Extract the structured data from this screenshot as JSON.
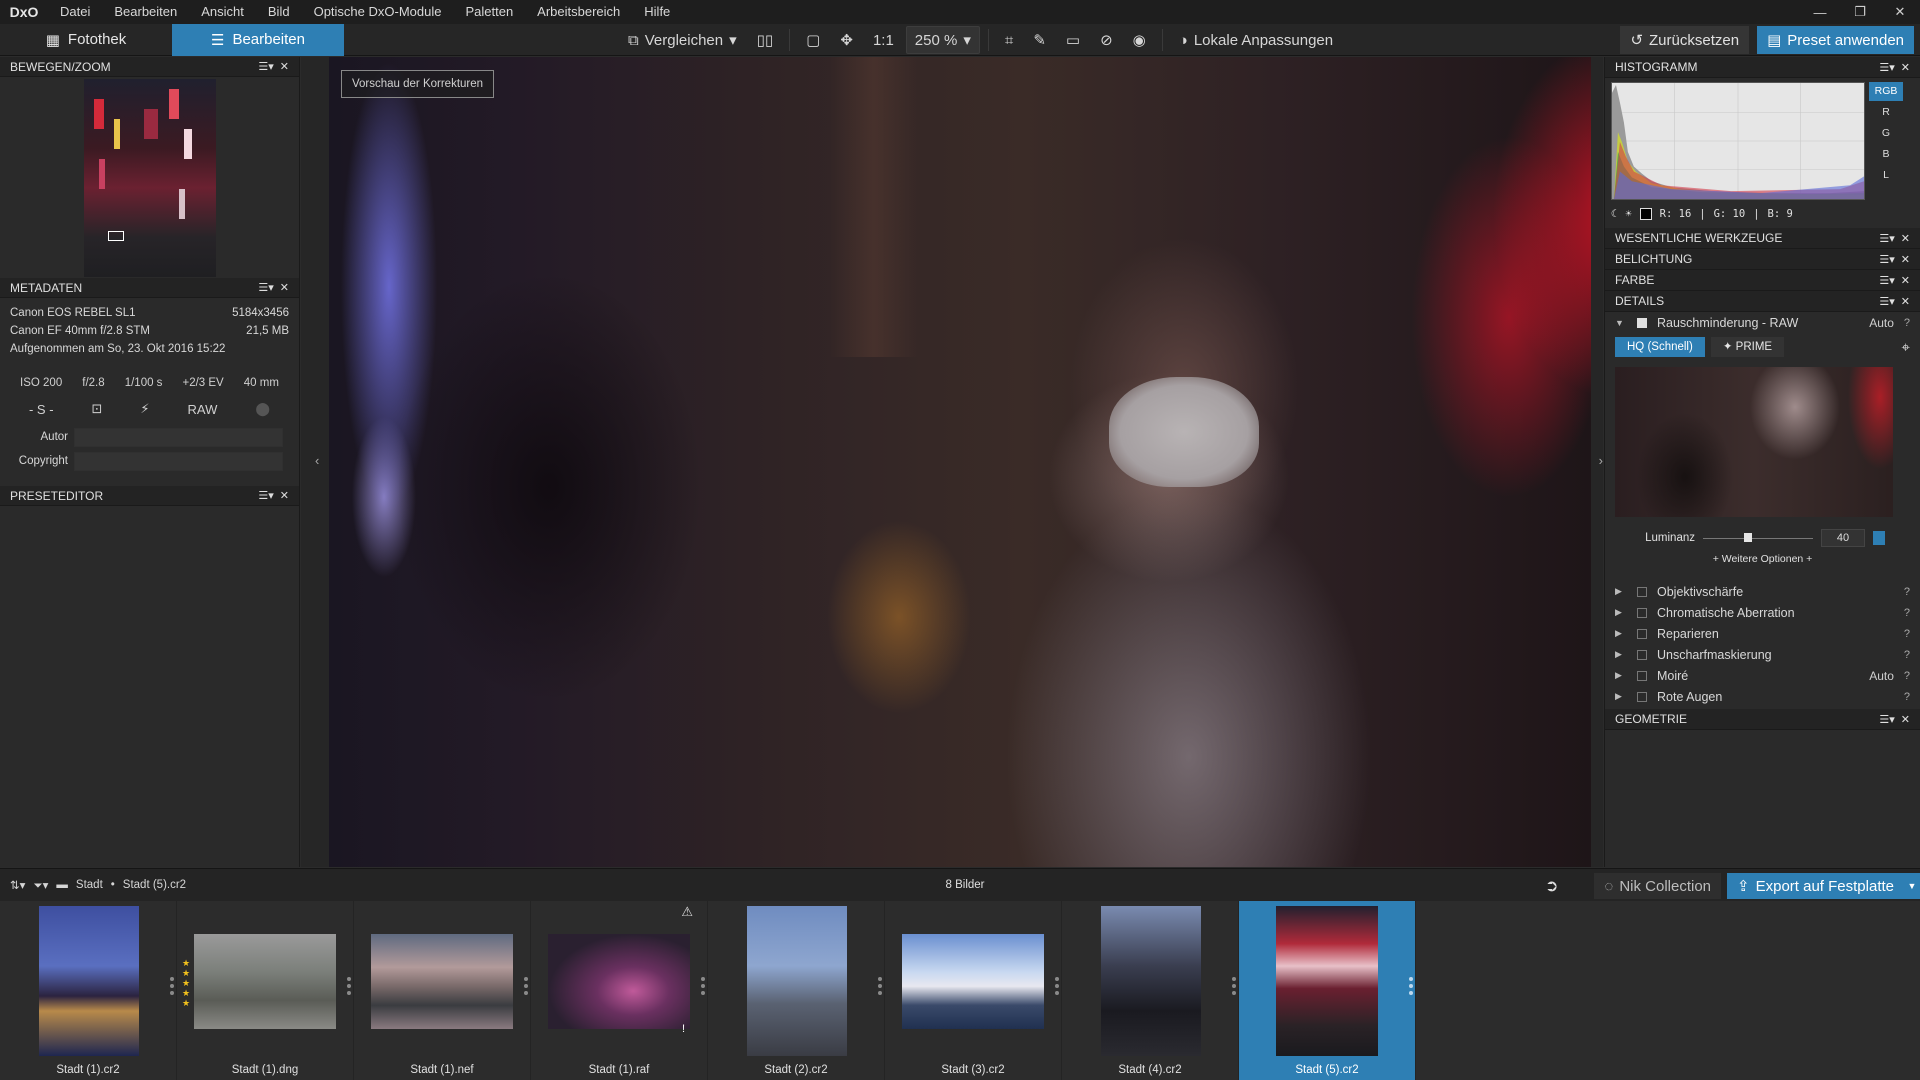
{
  "app": {
    "logo": "DxO",
    "menu": [
      "Datei",
      "Bearbeiten",
      "Ansicht",
      "Bild",
      "Optische DxO-Module",
      "Paletten",
      "Arbeitsbereich",
      "Hilfe"
    ]
  },
  "toolbar": {
    "tab_library": "Fotothek",
    "tab_edit": "Bearbeiten",
    "compare": "Vergleichen",
    "ratio": "1:1",
    "zoom": "250 %",
    "local_adjust": "Lokale Anpassungen",
    "reset": "Zurücksetzen",
    "apply_preset": "Preset anwenden"
  },
  "left": {
    "navigator_title": "BEWEGEN/ZOOM",
    "metadata_title": "METADATEN",
    "camera": "Canon EOS REBEL SL1",
    "resolution": "5184x3456",
    "lens": "Canon EF 40mm f/2.8 STM",
    "filesize": "21,5 MB",
    "taken": "Aufgenommen am So, 23. Okt 2016 15:22",
    "exif": [
      "ISO 200",
      "f/2.8",
      "1/100 s",
      "+2/3 EV",
      "40 mm"
    ],
    "mode": "- S -",
    "format": "RAW",
    "author_label": "Autor",
    "copyright_label": "Copyright",
    "preset_editor_title": "PRESETEDITOR"
  },
  "viewer": {
    "preview_label": "Vorschau der Korrekturen"
  },
  "right": {
    "histogram_title": "HISTOGRAMM",
    "channels": [
      "RGB",
      "R",
      "G",
      "B",
      "L"
    ],
    "readout": {
      "r": "R:  16",
      "g": "G:  10",
      "b": "B:  9"
    },
    "sections": {
      "essential": "WESENTLICHE WERKZEUGE",
      "exposure": "BELICHTUNG",
      "color": "FARBE",
      "details": "DETAILS",
      "geometry": "GEOMETRIE"
    },
    "noise": {
      "title": "Rauschminderung - RAW",
      "auto": "Auto",
      "mode_hq": "HQ (Schnell)",
      "mode_prime": "✦ PRIME",
      "luminance_label": "Luminanz",
      "luminance_value": "40",
      "more_options": "+ Weitere Optionen +"
    },
    "tools": [
      {
        "name": "Objektivschärfe",
        "auto": ""
      },
      {
        "name": "Chromatische Aberration",
        "auto": ""
      },
      {
        "name": "Reparieren",
        "auto": ""
      },
      {
        "name": "Unscharfmaskierung",
        "auto": ""
      },
      {
        "name": "Moiré",
        "auto": "Auto"
      },
      {
        "name": "Rote Augen",
        "auto": ""
      }
    ]
  },
  "strip": {
    "folder": "Stadt",
    "file": "Stadt (5).cr2",
    "count": "8 Bilder",
    "nik": "Nik Collection",
    "export": "Export auf Festplatte",
    "thumbs": [
      {
        "name": "Stadt (1).cr2",
        "stars": 0
      },
      {
        "name": "Stadt (1).dng",
        "stars": 5
      },
      {
        "name": "Stadt (1).nef",
        "stars": 0
      },
      {
        "name": "Stadt (1).raf",
        "stars": 0
      },
      {
        "name": "Stadt (2).cr2",
        "stars": 0
      },
      {
        "name": "Stadt (3).cr2",
        "stars": 0
      },
      {
        "name": "Stadt (4).cr2",
        "stars": 0
      },
      {
        "name": "Stadt (5).cr2",
        "stars": 0
      }
    ]
  }
}
